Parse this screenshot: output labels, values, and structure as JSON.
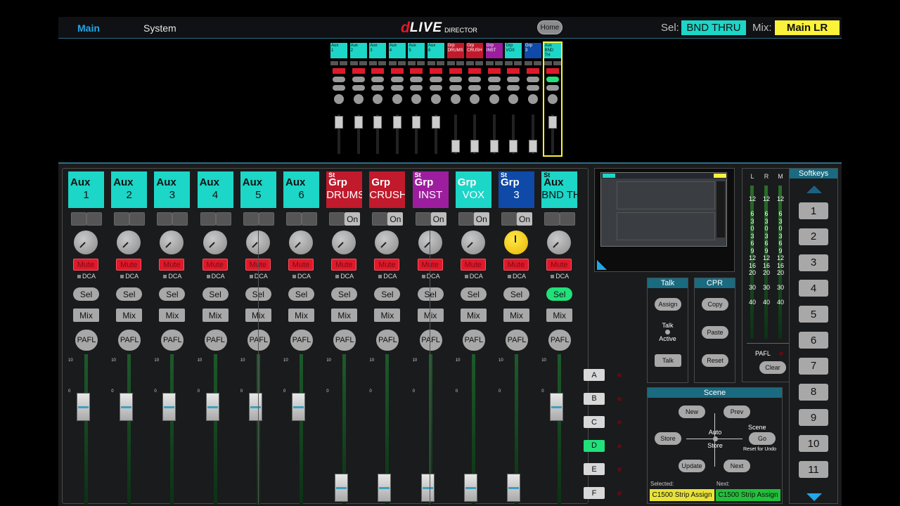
{
  "topbar": {
    "nav_main": "Main",
    "nav_system": "System",
    "logo_d": "d",
    "logo_live": "LIVE",
    "logo_director": "DIRECTOR",
    "home": "Home",
    "sel_label": "Sel:",
    "sel_value": "BND THRU",
    "mix_label": "Mix:",
    "mix_value": "Main LR"
  },
  "overview": {
    "strips": [
      {
        "l1": "Aux",
        "l2": "1",
        "c": "teal"
      },
      {
        "l1": "Aux",
        "l2": "2",
        "c": "teal"
      },
      {
        "l1": "Aux",
        "l2": "3",
        "c": "teal"
      },
      {
        "l1": "Aux",
        "l2": "4",
        "c": "teal"
      },
      {
        "l1": "Aux",
        "l2": "5",
        "c": "teal"
      },
      {
        "l1": "Aux",
        "l2": "6",
        "c": "teal"
      },
      {
        "l1": "Grp",
        "l2": "DRUMS",
        "c": "red"
      },
      {
        "l1": "Grp",
        "l2": "CRUSH",
        "c": "red"
      },
      {
        "l1": "Grp",
        "l2": "INST",
        "c": "purple"
      },
      {
        "l1": "Grp",
        "l2": "VOX",
        "c": "teal"
      },
      {
        "l1": "Grp",
        "l2": "3",
        "c": "blue"
      },
      {
        "l1": "Aux",
        "l2": "BND TH",
        "c": "teal"
      }
    ]
  },
  "strips": [
    {
      "st": "",
      "l1": "Aux",
      "l2": "1",
      "color": "teal",
      "on": "",
      "mute": "Mute",
      "dca": "DCA",
      "sel": "Sel",
      "mix": "Mix",
      "pafl": "PAFL",
      "fader": 0.5
    },
    {
      "st": "",
      "l1": "Aux",
      "l2": "2",
      "color": "teal",
      "on": "",
      "mute": "Mute",
      "dca": "DCA",
      "sel": "Sel",
      "mix": "Mix",
      "pafl": "PAFL",
      "fader": 0.5
    },
    {
      "st": "",
      "l1": "Aux",
      "l2": "3",
      "color": "teal",
      "on": "",
      "mute": "Mute",
      "dca": "DCA",
      "sel": "Sel",
      "mix": "Mix",
      "pafl": "PAFL",
      "fader": 0.5
    },
    {
      "st": "",
      "l1": "Aux",
      "l2": "4",
      "color": "teal",
      "on": "",
      "mute": "Mute",
      "dca": "DCA",
      "sel": "Sel",
      "mix": "Mix",
      "pafl": "PAFL",
      "fader": 0.5
    },
    {
      "st": "",
      "l1": "Aux",
      "l2": "5",
      "color": "teal",
      "on": "",
      "mute": "Mute",
      "dca": "DCA",
      "sel": "Sel",
      "mix": "Mix",
      "pafl": "PAFL",
      "fader": 0.5
    },
    {
      "st": "",
      "l1": "Aux",
      "l2": "6",
      "color": "teal",
      "on": "",
      "mute": "Mute",
      "dca": "DCA",
      "sel": "Sel",
      "mix": "Mix",
      "pafl": "PAFL",
      "fader": 0.5
    },
    {
      "st": "St",
      "l1": "Grp",
      "l2": "DRUMS",
      "color": "red",
      "on": "On",
      "mute": "Mute",
      "dca": "DCA",
      "sel": "Sel",
      "mix": "Mix",
      "pafl": "PAFL",
      "fader": 0.0
    },
    {
      "st": "",
      "l1": "Grp",
      "l2": "CRUSH",
      "color": "red",
      "on": "On",
      "mute": "Mute",
      "dca": "DCA",
      "sel": "Sel",
      "mix": "Mix",
      "pafl": "PAFL",
      "fader": 0.0
    },
    {
      "st": "St",
      "l1": "Grp",
      "l2": "INST",
      "color": "purple",
      "on": "On",
      "mute": "Mute",
      "dca": "DCA",
      "sel": "Sel",
      "mix": "Mix",
      "pafl": "PAFL",
      "fader": 0.0
    },
    {
      "st": "",
      "l1": "Grp",
      "l2": "VOX",
      "color": "teal-w",
      "on": "On",
      "mute": "Mute",
      "dca": "DCA",
      "sel": "Sel",
      "mix": "Mix",
      "pafl": "PAFL",
      "fader": 0.0
    },
    {
      "st": "St",
      "l1": "Grp",
      "l2": "3",
      "color": "blue",
      "on": "On",
      "mute": "Mute",
      "dca": "DCA",
      "sel": "Sel",
      "mix": "Mix",
      "pafl": "PAFL",
      "fader": 0.0
    },
    {
      "st": "St",
      "l1": "Aux",
      "l2": "BND TH",
      "color": "teal",
      "on": "",
      "mute": "Mute",
      "dca": "DCA",
      "sel": "Sel",
      "mix": "Mix",
      "pafl": "PAFL",
      "fader": 0.5
    }
  ],
  "fader_scale": {
    "top": "10",
    "mid": "0"
  },
  "banks": [
    {
      "label": "A",
      "on": false
    },
    {
      "label": "B",
      "on": false
    },
    {
      "label": "C",
      "on": false
    },
    {
      "label": "D",
      "on": true
    },
    {
      "label": "E",
      "on": false
    },
    {
      "label": "F",
      "on": false
    }
  ],
  "talk": {
    "title": "Talk",
    "assign": "Assign",
    "talk_active_1": "Talk",
    "talk_active_2": "Active",
    "talk_btn": "Talk"
  },
  "cpr": {
    "title": "CPR",
    "copy": "Copy",
    "paste": "Paste",
    "reset": "Reset"
  },
  "meters": {
    "headers": [
      "L",
      "R",
      "M"
    ],
    "scale": [
      "12",
      "",
      "6",
      "3",
      "0",
      "3",
      "6",
      "9",
      "12",
      "16",
      "20",
      "",
      "30",
      "",
      "40"
    ],
    "pafl": "PAFL",
    "clear": "Clear"
  },
  "scene": {
    "title": "Scene",
    "new": "New",
    "prev": "Prev",
    "store": "Store",
    "auto_store_1": "Auto",
    "auto_store_2": "Store",
    "scene_go_label": "Scene",
    "go": "Go",
    "reset_undo": "Reset for Undo",
    "update": "Update",
    "next": "Next",
    "selected_label": "Selected:",
    "selected_value": "C1500 Strip Assign",
    "next_label": "Next:",
    "next_value": "C1500 Strip Assign"
  },
  "softkeys": {
    "title": "Softkeys",
    "keys": [
      "1",
      "2",
      "3",
      "4",
      "5",
      "6",
      "7",
      "8",
      "9",
      "10",
      "11"
    ]
  }
}
